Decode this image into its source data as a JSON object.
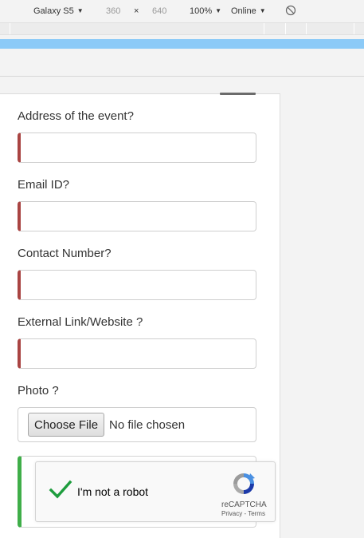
{
  "devtools": {
    "device": "Galaxy S5",
    "width": "360",
    "times": "×",
    "height": "640",
    "zoom": "100%",
    "network": "Online"
  },
  "form": {
    "address_label": "Address of the event?",
    "email_label": "Email ID?",
    "contact_label": "Contact Number?",
    "external_label": "External Link/Website ?",
    "photo_label": "Photo ?",
    "address_value": "",
    "email_value": "",
    "contact_value": "",
    "external_value": "",
    "choose_file": "Choose File",
    "no_file": "No file chosen"
  },
  "captcha": {
    "text": "I'm not a robot",
    "brand": "reCAPTCHA",
    "links": "Privacy - Terms",
    "checked": true
  },
  "colors": {
    "invalid": "#a94442",
    "valid": "#3fae49",
    "devtools_blue": "#8ccaf7"
  }
}
